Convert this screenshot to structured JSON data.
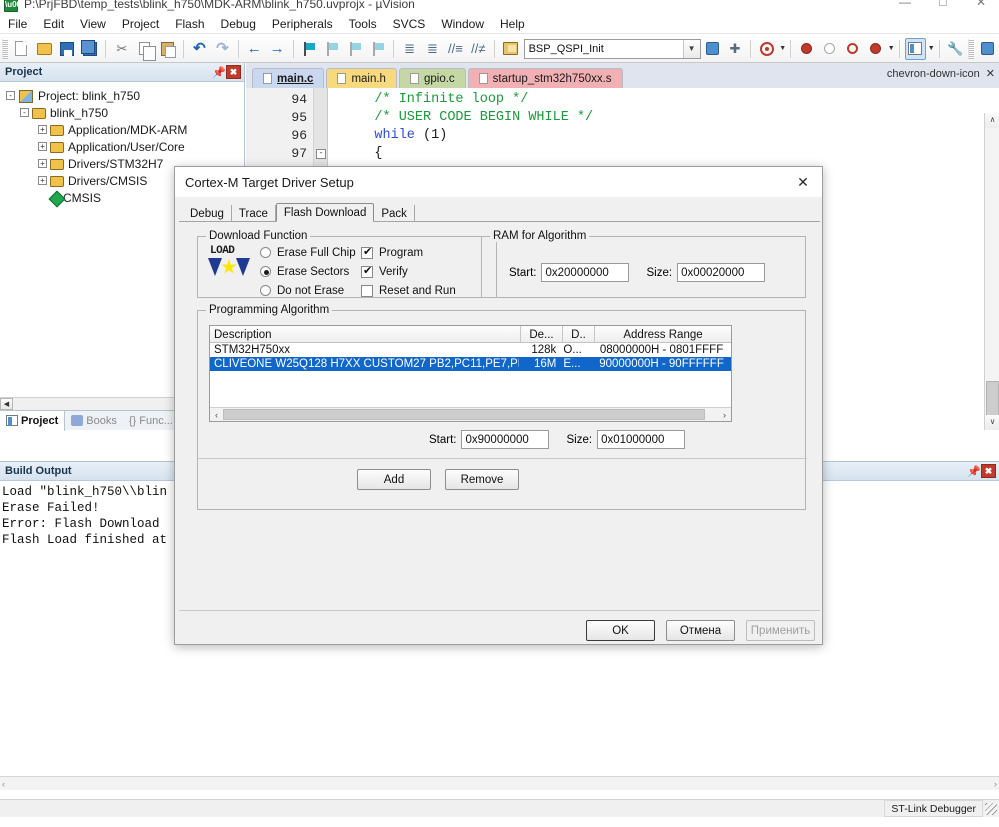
{
  "window": {
    "title": "P:\\PrjFBD\\temp_tests\\blink_h750\\MDK-ARM\\blink_h750.uvprojx - µVision",
    "app_icon": "uvision-icon",
    "minimize": "—",
    "maximize": "□",
    "close": "✕"
  },
  "menu": {
    "items": [
      "File",
      "Edit",
      "View",
      "Project",
      "Flash",
      "Debug",
      "Peripherals",
      "Tools",
      "SVCS",
      "Window",
      "Help"
    ]
  },
  "toolbar": {
    "target_combo_value": "BSP_QSPI_Init",
    "combo_arrow": "▼",
    "icons": [
      "new-file-icon",
      "open-file-icon",
      "save-icon",
      "save-all-icon",
      "cut-icon",
      "copy-icon",
      "paste-icon",
      "undo-icon",
      "redo-icon",
      "navigate-back-icon",
      "navigate-forward-icon",
      "bookmark-toggle-icon",
      "bookmark-prev-icon",
      "bookmark-next-icon",
      "bookmark-clear-icon",
      "indent-icon",
      "outdent-icon",
      "comment-icon",
      "uncomment-icon",
      "target-options-icon",
      "batch-build-icon",
      "manage-runtime-icon",
      "find-in-files-icon",
      "insert-breakpoint-icon",
      "disable-breakpoint-icon",
      "kill-all-breakpoints-icon",
      "disable-all-breakpoints-icon",
      "window-layout-icon",
      "configure-icon",
      "manage-project-icon"
    ]
  },
  "project_panel": {
    "title": "Project",
    "pin_icon": "pin-icon",
    "close_icon": "close-icon",
    "tree": [
      {
        "label": "Project: blink_h750",
        "icon": "project-icon",
        "toggle": "-",
        "depth": 0
      },
      {
        "label": "blink_h750",
        "icon": "target-icon",
        "toggle": "-",
        "depth": 1
      },
      {
        "label": "Application/MDK-ARM",
        "icon": "folder-icon",
        "toggle": "+",
        "depth": 2
      },
      {
        "label": "Application/User/Core",
        "icon": "folder-icon",
        "toggle": "+",
        "depth": 2
      },
      {
        "label": "Drivers/STM32H7",
        "icon": "folder-icon",
        "toggle": "+",
        "depth": 2
      },
      {
        "label": "Drivers/CMSIS",
        "icon": "folder-icon",
        "toggle": "+",
        "depth": 2
      },
      {
        "label": "CMSIS",
        "icon": "cmsis-icon",
        "toggle": "",
        "depth": 2
      }
    ],
    "bottom_tabs": [
      {
        "label": "Project",
        "icon": "project-tab-icon",
        "active": true
      },
      {
        "label": "Books",
        "icon": "books-icon",
        "active": false
      },
      {
        "label": "Func...",
        "icon": "functions-icon",
        "active": false
      }
    ]
  },
  "editor": {
    "tabs": [
      {
        "label": "main.c",
        "color": "#c9d7ef",
        "active": true
      },
      {
        "label": "main.h",
        "color": "#f7d97e",
        "active": false
      },
      {
        "label": "gpio.c",
        "color": "#c4d7a4",
        "active": false
      },
      {
        "label": "startup_stm32h750xx.s",
        "color": "#f0b0b4",
        "active": false
      }
    ],
    "tab_dropdown_icon": "chevron-down-icon",
    "tab_close_icon": "close-icon",
    "lines": [
      {
        "num": "94",
        "fold": "",
        "tokens": [
          {
            "t": "    ",
            "c": "pl"
          },
          {
            "t": "/* Infinite loop */",
            "c": "cm"
          }
        ]
      },
      {
        "num": "95",
        "fold": "",
        "tokens": [
          {
            "t": "    ",
            "c": "pl"
          },
          {
            "t": "/* USER CODE BEGIN WHILE */",
            "c": "cm"
          }
        ]
      },
      {
        "num": "96",
        "fold": "",
        "tokens": [
          {
            "t": "    ",
            "c": "pl"
          },
          {
            "t": "while",
            "c": "kw"
          },
          {
            "t": " (1)",
            "c": "pl"
          }
        ]
      },
      {
        "num": "97",
        "fold": "-",
        "tokens": [
          {
            "t": "    {",
            "c": "pl"
          }
        ]
      }
    ],
    "scroll_up": "∧",
    "scroll_down": "∨"
  },
  "build_output": {
    "title": "Build Output",
    "pin_icon": "pin-icon",
    "close_icon": "close-icon",
    "lines": [
      "Load \"blink_h750\\\\blin",
      "Erase Failed!",
      "Error: Flash Download ",
      "Flash Load finished at"
    ],
    "scroll_left": "‹",
    "scroll_right": "›"
  },
  "status_bar": {
    "debugger": "ST-Link Debugger"
  },
  "dialog": {
    "title": "Cortex-M Target Driver Setup",
    "close_icon": "close-icon",
    "tabs": [
      {
        "label": "Debug",
        "active": false
      },
      {
        "label": "Trace",
        "active": false
      },
      {
        "label": "Flash Download",
        "active": true
      },
      {
        "label": "Pack",
        "active": false
      }
    ],
    "download_function": {
      "legend": "Download Function",
      "icon": "load-icon",
      "icon_text": "LOAD",
      "radios": [
        {
          "label": "Erase Full Chip",
          "checked": false
        },
        {
          "label": "Erase Sectors",
          "checked": true
        },
        {
          "label": "Do not Erase",
          "checked": false
        }
      ],
      "checkboxes": [
        {
          "label": "Program",
          "checked": true
        },
        {
          "label": "Verify",
          "checked": true
        },
        {
          "label": "Reset and Run",
          "checked": false
        }
      ],
      "check_glyph": "✔"
    },
    "ram_for_algorithm": {
      "legend": "RAM for Algorithm",
      "start_label": "Start:",
      "start_value": "0x20000000",
      "size_label": "Size:",
      "size_value": "0x00020000"
    },
    "programming_algorithm": {
      "legend": "Programming Algorithm",
      "columns": [
        "Description",
        "De...",
        "D..",
        "Address Range"
      ],
      "rows": [
        {
          "description": "STM32H750xx",
          "device_size": "128k",
          "device_type": "O...",
          "address_range": "08000000H - 0801FFFF",
          "selected": false
        },
        {
          "description": "CLIVEONE W25Q128 H7XX CUSTOM27 PB2,PC11,PE7,PE8,P...",
          "device_size": "16M",
          "device_type": "E...",
          "address_range": "90000000H - 90FFFFFF",
          "selected": true
        }
      ],
      "scroll_left": "‹",
      "scroll_right": "›",
      "start_label": "Start:",
      "start_value": "0x90000000",
      "size_label": "Size:",
      "size_value": "0x01000000",
      "add_button": "Add",
      "remove_button": "Remove"
    },
    "buttons": {
      "ok": "OK",
      "cancel": "Отмена",
      "apply": "Применить"
    }
  },
  "colors": {
    "selection_blue": "#1066c9",
    "panel_header": "#d6e3ef",
    "dialog_bg": "#f0f0f0",
    "comment_green": "#1a9a3a",
    "keyword_blue": "#2c4bdc"
  }
}
